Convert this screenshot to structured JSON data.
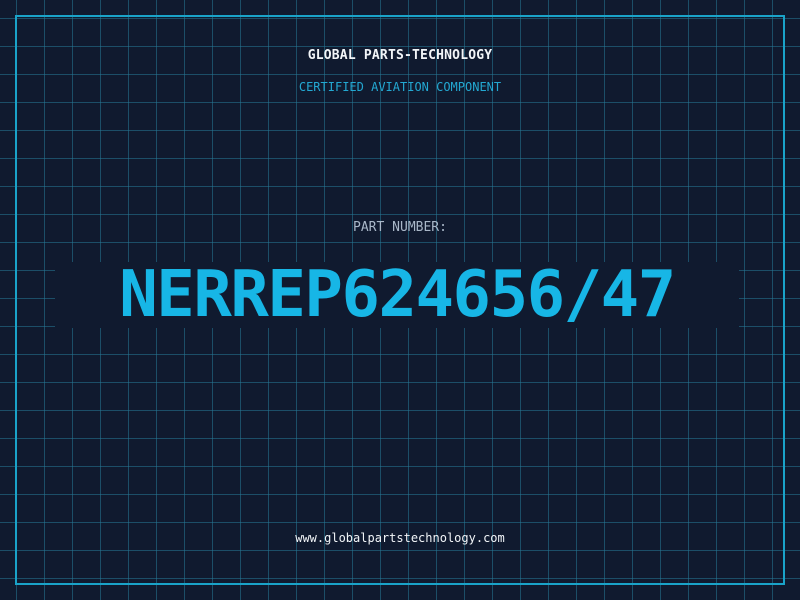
{
  "header": {
    "company": "GLOBAL PARTS-TECHNOLOGY",
    "subtitle": "CERTIFIED AVIATION COMPONENT"
  },
  "part": {
    "label": "PART NUMBER:",
    "number": "NERREP624656/47"
  },
  "footer": {
    "website": "www.globalpartstechnology.com"
  },
  "colors": {
    "background": "#101a2f",
    "grid": "#26789a",
    "frame": "#1aa3c9",
    "accent": "#17b6e6",
    "text": "#f2f5f8",
    "muted": "#a9b7c8"
  }
}
